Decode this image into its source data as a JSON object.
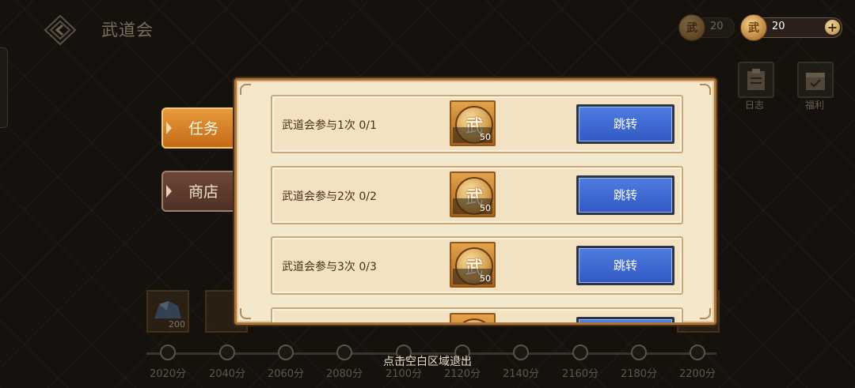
{
  "header": {
    "title": "武道会"
  },
  "currencies": [
    {
      "symbol": "武",
      "value": "20"
    },
    {
      "symbol": "武",
      "value": "20",
      "plus": "+"
    }
  ],
  "side_icons": [
    {
      "icon": "journal-icon",
      "label": "日志"
    },
    {
      "icon": "gift-calendar-icon",
      "label": "福利"
    }
  ],
  "tabs": [
    {
      "label": "任务",
      "active": true
    },
    {
      "label": "商店",
      "active": false
    }
  ],
  "milestone": {
    "reward_count": "200",
    "nodes": [
      "2020分",
      "2040分",
      "2060分",
      "2080分",
      "2100分",
      "2120分",
      "2140分",
      "2160分",
      "2180分",
      "2200分"
    ]
  },
  "exit_hint": "点击空白区域退出",
  "tasks": [
    {
      "text": "武道会参与1次 0/1",
      "reward_symbol": "武",
      "reward_count": "50",
      "button": "跳转"
    },
    {
      "text": "武道会参与2次 0/2",
      "reward_symbol": "武",
      "reward_count": "50",
      "button": "跳转"
    },
    {
      "text": "武道会参与3次 0/3",
      "reward_symbol": "武",
      "reward_count": "50",
      "button": "跳转"
    },
    {
      "text": "",
      "reward_symbol": "武",
      "reward_count": "",
      "button": ""
    }
  ],
  "colors": {
    "tab_active": "#e08a2c",
    "tab_inactive": "#5e3a2e",
    "jump_button": "#3d68d4",
    "dialog_bg": "#f4e8cc"
  }
}
